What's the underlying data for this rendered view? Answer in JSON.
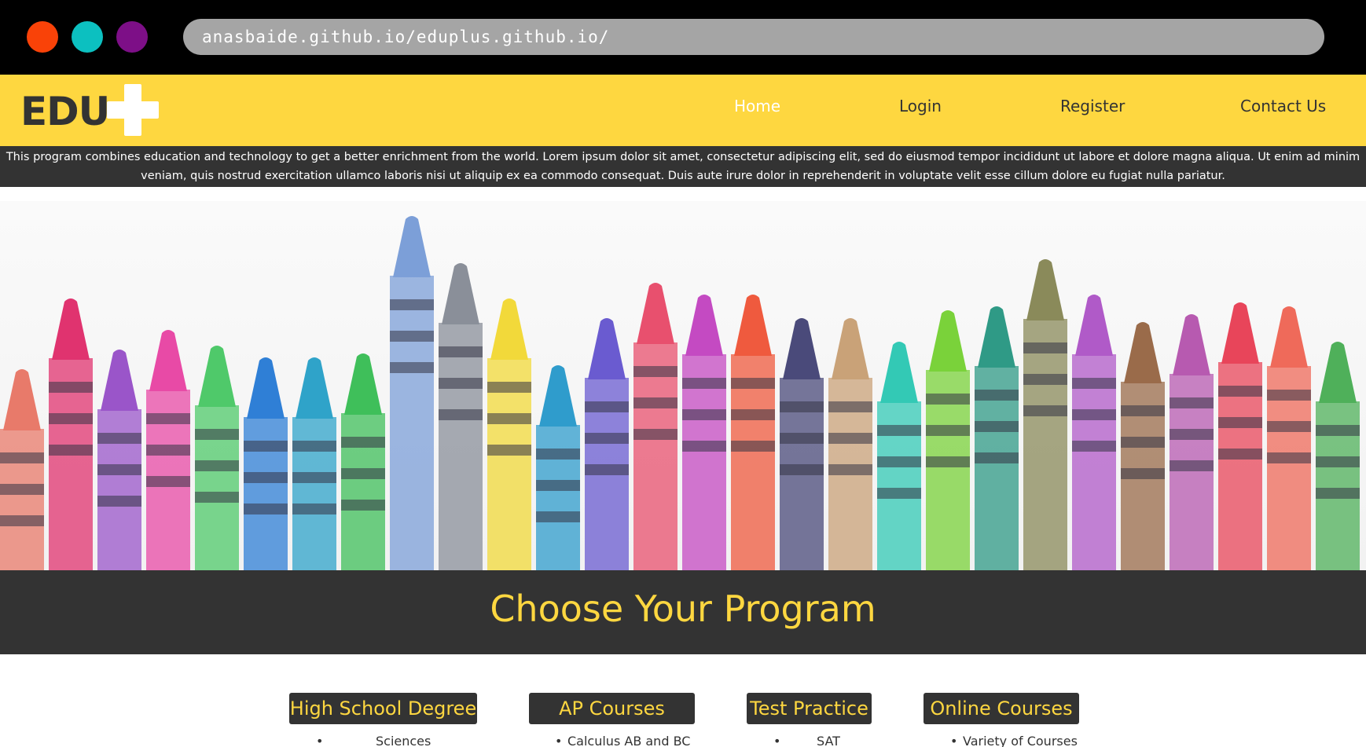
{
  "browser": {
    "url": "anasbaide.github.io/eduplus.github.io/",
    "dots": [
      "#f94208",
      "#0cc0c0",
      "#7d0f87"
    ]
  },
  "navbar": {
    "logo_text": "EDU",
    "links": [
      "Home",
      "Login",
      "Register",
      "Contact Us"
    ],
    "active": "Home",
    "bg_color": "#fed740"
  },
  "info": {
    "text": "This program combines education and technology to get a better enrichment from the world. Lorem ipsum dolor sit amet, consectetur adipiscing elit, sed do eiusmod tempor incididunt ut labore et dolore magna aliqua. Ut enim ad minim veniam, quis nostrud exercitation ullamco laboris nisi ut aliquip ex ea commodo consequat. Duis aute irure dolor in reprehenderit in voluptate velit esse cillum dolore eu fugiat nulla pariatur."
  },
  "hero": {
    "image": "crayons-photo"
  },
  "programs": {
    "title": "Choose Your Program",
    "items": [
      {
        "label": "High School Degree",
        "first_item": "Sciences"
      },
      {
        "label": "AP Courses",
        "first_item": "Calculus AB and BC"
      },
      {
        "label": "Test Practice",
        "first_item": "SAT"
      },
      {
        "label": "Online Courses",
        "first_item": "Variety of Courses"
      }
    ]
  },
  "colors": {
    "accent": "#fed740",
    "dark": "#333333"
  }
}
